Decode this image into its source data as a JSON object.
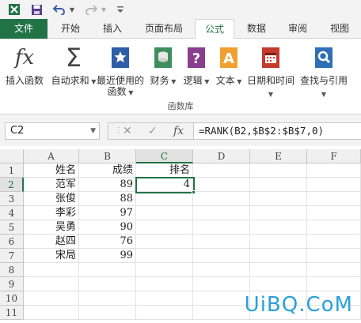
{
  "quick_access": {
    "excel_icon": "excel-app-icon",
    "save_icon": "save-icon",
    "undo_icon": "undo-icon",
    "redo_icon": "redo-icon",
    "customize_icon": "customize-toolbar-icon"
  },
  "tabs": [
    {
      "label": "文件"
    },
    {
      "label": "开始"
    },
    {
      "label": "插入"
    },
    {
      "label": "页面布局"
    },
    {
      "label": "公式"
    },
    {
      "label": "数据"
    },
    {
      "label": "审阅"
    },
    {
      "label": "视图"
    }
  ],
  "active_tab": "公式",
  "ribbon": {
    "insert_function": "插入函数",
    "autosum": "自动求和",
    "recent_line1": "最近使用的",
    "recent_line2": "函数",
    "financial": "财务",
    "logical": "逻辑",
    "text": "文本",
    "datetime": "日期和时间",
    "lookup": "查找与引用",
    "group_label": "函数库"
  },
  "formula_bar": {
    "name_box": "C2",
    "formula": "=RANK(B2,$B$2:$B$7,0)"
  },
  "columns": [
    "A",
    "B",
    "C",
    "D",
    "E",
    "F"
  ],
  "rows": [
    "1",
    "2",
    "3",
    "4",
    "5",
    "6",
    "7",
    "8",
    "9",
    "10",
    "11"
  ],
  "sheet": {
    "header": {
      "name": "姓名",
      "score": "成绩",
      "rank": "排名"
    },
    "records": [
      {
        "name": "范军",
        "score": "89",
        "rank": "4"
      },
      {
        "name": "张俊",
        "score": "88",
        "rank": ""
      },
      {
        "name": "李彩",
        "score": "97",
        "rank": ""
      },
      {
        "name": "吴勇",
        "score": "90",
        "rank": ""
      },
      {
        "name": "赵四",
        "score": "76",
        "rank": ""
      },
      {
        "name": "宋局",
        "score": "99",
        "rank": ""
      }
    ]
  },
  "selected_cell": "C2",
  "watermark": "UiBQ.CoM",
  "colors": {
    "accent": "#217346",
    "watermark": "#2ba0d8"
  }
}
